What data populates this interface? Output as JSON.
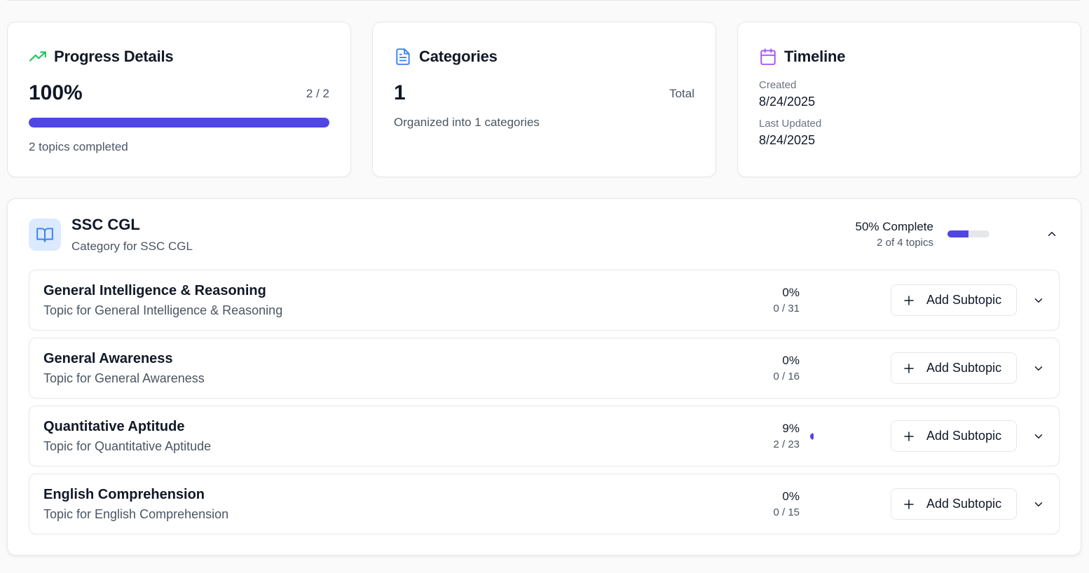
{
  "colors": {
    "accent": "#4f46e5",
    "trend": "#22c55e",
    "doc": "#3b82f6",
    "calendar": "#a855f7"
  },
  "progress_card": {
    "title": "Progress Details",
    "icon": "trending-up-icon",
    "percent": "100%",
    "fraction": "2 / 2",
    "progress_value": 1.0,
    "completed_text": "2 topics completed"
  },
  "categories_card": {
    "title": "Categories",
    "icon": "document-icon",
    "count": "1",
    "total_label": "Total",
    "organized_text": "Organized into 1 categories"
  },
  "timeline_card": {
    "title": "Timeline",
    "icon": "calendar-icon",
    "created_label": "Created",
    "created_value": "8/24/2025",
    "updated_label": "Last Updated",
    "updated_value": "8/24/2025"
  },
  "category": {
    "icon": "book-open-icon",
    "title": "SSC CGL",
    "subtitle": "Category for SSC CGL",
    "percent_text": "50% Complete",
    "topics_text": "2 of 4 topics",
    "progress_value": 0.5,
    "collapse_icon": "chevron-up-icon"
  },
  "topics": [
    {
      "title": "General Intelligence & Reasoning",
      "subtitle": "Topic for General Intelligence & Reasoning",
      "percent": "0%",
      "count": "0 / 31",
      "progress_value": 0.0,
      "add_label": "Add Subtopic"
    },
    {
      "title": "General Awareness",
      "subtitle": "Topic for General Awareness",
      "percent": "0%",
      "count": "0 / 16",
      "progress_value": 0.0,
      "add_label": "Add Subtopic"
    },
    {
      "title": "Quantitative Aptitude",
      "subtitle": "Topic for Quantitative Aptitude",
      "percent": "9%",
      "count": "2 / 23",
      "progress_value": 0.09,
      "add_label": "Add Subtopic"
    },
    {
      "title": "English Comprehension",
      "subtitle": "Topic for English Comprehension",
      "percent": "0%",
      "count": "0 / 15",
      "progress_value": 0.0,
      "add_label": "Add Subtopic"
    }
  ]
}
